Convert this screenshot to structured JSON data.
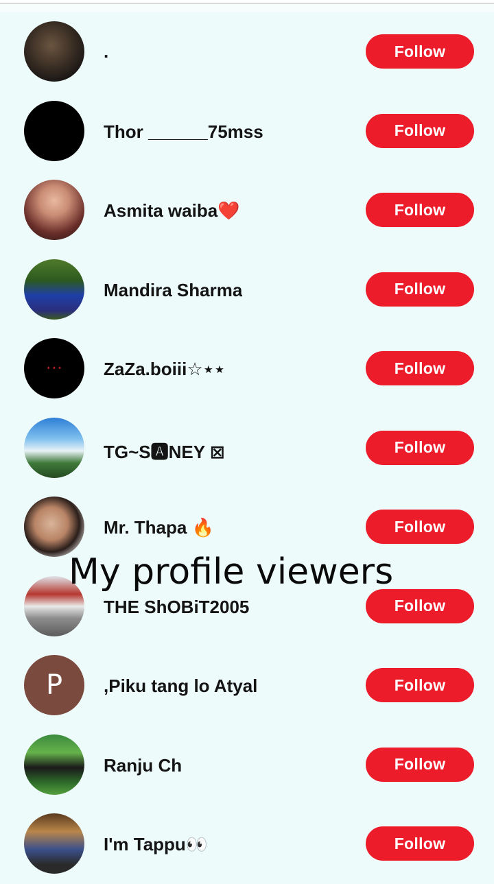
{
  "caption": "My profile viewers",
  "follow_label": "Follow",
  "viewers": [
    {
      "name": ".",
      "avatar": "photo-dark"
    },
    {
      "name": "Thor ______75mss",
      "avatar": "black"
    },
    {
      "name": "Asmita waiba❤️",
      "avatar": "photo-portrait"
    },
    {
      "name": "Mandira Sharma",
      "avatar": "photo-outdoor-blue"
    },
    {
      "name": "ZaZa.boiii☆⋆⋆",
      "avatar": "black-with-text"
    },
    {
      "name": "TG~S🅰NEY ⊠",
      "avatar": "photo-sky"
    },
    {
      "name": "Mr. Thapa 🔥",
      "avatar": "photo-sunglasses"
    },
    {
      "name": "THE ShOBiT2005",
      "avatar": "photo-street"
    },
    {
      "name": ",Piku tang lo Atyal",
      "avatar": "letter",
      "letter": "P"
    },
    {
      "name": "Ranju Ch",
      "avatar": "photo-garden"
    },
    {
      "name": "I'm Tappu👀",
      "avatar": "photo-room"
    }
  ],
  "avatar_colors": {
    "letter_bg": "#7a4a3f",
    "button_bg": "#ec1c2b",
    "page_bg": "#eefbfb"
  }
}
